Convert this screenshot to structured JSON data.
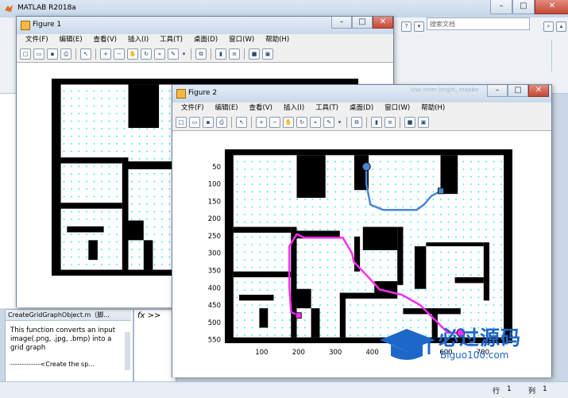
{
  "main_window": {
    "title": "MATLAB R2018a",
    "search_placeholder": "搜索文档",
    "details": {
      "file": "CreateGridGraphObject.m（脚...",
      "description": "This function converts an input image(.png, .jpg, .bmp) into a grid graph",
      "more": "-------------<Create the sp..."
    },
    "command_prompt": "fx >>",
    "status": {
      "row_label": "行",
      "row_value": "1",
      "col_label": "列",
      "col_value": "1"
    }
  },
  "figure1": {
    "title": "Figure 1",
    "menu": [
      "文件(F)",
      "编辑(E)",
      "查看(V)",
      "插入(I)",
      "工具(T)",
      "桌面(D)",
      "窗口(W)",
      "帮助(H)"
    ]
  },
  "figure2": {
    "title": "Figure 2",
    "menu": [
      "文件(F)",
      "编辑(E)",
      "查看(V)",
      "插入(I)",
      "工具(T)",
      "桌面(D)",
      "窗口(W)",
      "帮助(H)"
    ],
    "overlay_hint": "Use inner bright, mapbe"
  },
  "chart_data": {
    "type": "image-plot",
    "xticks": [
      "100",
      "200",
      "300",
      "400",
      "500",
      "600",
      "700"
    ],
    "yticks": [
      "50",
      "100",
      "150",
      "200",
      "250",
      "300",
      "350",
      "400",
      "450",
      "500",
      "550"
    ],
    "xlim": [
      0,
      780
    ],
    "ylim": [
      0,
      560
    ],
    "series": [
      {
        "color": "#4a86d6",
        "points": [
          [
            384,
            50
          ],
          [
            384,
            100
          ],
          [
            395,
            160
          ],
          [
            430,
            175
          ],
          [
            520,
            175
          ],
          [
            540,
            160
          ],
          [
            560,
            135
          ],
          [
            586,
            120
          ]
        ]
      },
      {
        "color": "#ff2cf2",
        "points": [
          [
            200,
            480
          ],
          [
            180,
            470
          ],
          [
            175,
            400
          ],
          [
            175,
            280
          ],
          [
            195,
            245
          ],
          [
            215,
            255
          ],
          [
            320,
            255
          ],
          [
            345,
            300
          ],
          [
            350,
            325
          ],
          [
            390,
            370
          ],
          [
            420,
            405
          ],
          [
            480,
            420
          ],
          [
            530,
            450
          ],
          [
            605,
            530
          ],
          [
            640,
            530
          ]
        ]
      }
    ],
    "markers": [
      {
        "x": 384,
        "y": 50,
        "color": "#4a86d6",
        "shape": "circle"
      },
      {
        "x": 586,
        "y": 120,
        "color": "#4a86d6",
        "shape": "square"
      },
      {
        "x": 200,
        "y": 480,
        "color": "#ff2cf2",
        "shape": "square"
      },
      {
        "x": 640,
        "y": 530,
        "color": "#ff2cf2",
        "shape": "circle"
      }
    ]
  },
  "watermark": {
    "text": "必过源码",
    "domain": "Biguo100.com"
  },
  "colors": {
    "grid_dot": "#22e4ee",
    "wall": "#000000",
    "blue_path": "#4a86d6",
    "pink_path": "#ff2cf2"
  }
}
